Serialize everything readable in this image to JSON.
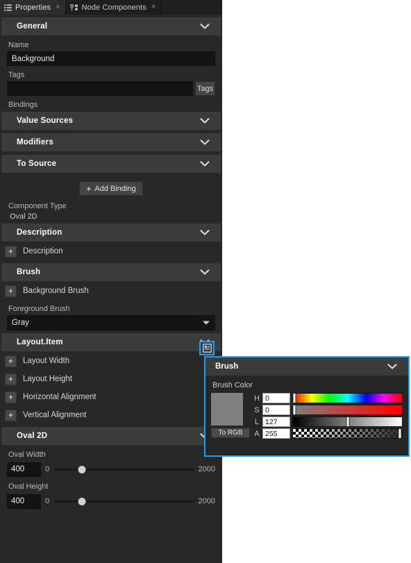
{
  "tabs": [
    {
      "label": "Properties",
      "icon": "list-icon",
      "close": "×",
      "active": true
    },
    {
      "label": "Node Components",
      "icon": "node-graph-icon",
      "close": "×",
      "active": false
    }
  ],
  "sections": {
    "general": {
      "title": "General",
      "chevron": "chevron-down-icon"
    },
    "description": {
      "title": "Description",
      "chevron": "chevron-down-icon"
    },
    "brush": {
      "title": "Brush",
      "chevron": "chevron-down-icon"
    },
    "layout_item": {
      "title": "Layout.Item",
      "chevron": "chevron-down-icon"
    },
    "oval2d": {
      "title": "Oval 2D",
      "chevron": "chevron-down-icon"
    }
  },
  "general": {
    "name_label": "Name",
    "name_value": "Background",
    "tags_label": "Tags",
    "tags_value": "",
    "tags_placeholder": "",
    "tags_button": "Tags",
    "bindings_label": "Bindings",
    "binding_groups": [
      {
        "title": "Value Sources",
        "chevron": "chevron-down-icon"
      },
      {
        "title": "Modifiers",
        "chevron": "chevron-down-icon"
      },
      {
        "title": "To Source",
        "chevron": "chevron-down-icon"
      }
    ],
    "add_binding": "Add Binding",
    "add_binding_plus": "+",
    "component_type_label": "Component Type",
    "component_type_value": "Oval 2D"
  },
  "description_rows": [
    {
      "expander": "+",
      "label": "Description"
    }
  ],
  "brush_section": {
    "rows": [
      {
        "expander": "+",
        "label": "Background Brush"
      }
    ],
    "foreground_label": "Foreground Brush",
    "foreground_value": "Gray",
    "edit_button_icon": "brush-editor-icon"
  },
  "layout_rows": [
    {
      "expander": "+",
      "label": "Layout Width"
    },
    {
      "expander": "+",
      "label": "Layout Height"
    },
    {
      "expander": "+",
      "label": "Horizontal Alignment"
    },
    {
      "expander": "+",
      "label": "Vertical Alignment"
    }
  ],
  "oval2d": {
    "width_label": "Oval Width",
    "width_value": "400",
    "width_min": "0",
    "width_max": "2000",
    "width_percent": 20,
    "height_label": "Oval Height",
    "height_value": "400",
    "height_min": "0",
    "height_max": "2000",
    "height_percent": 20
  },
  "popup": {
    "title": "Brush",
    "chevron": "chevron-down-icon",
    "subtitle": "Brush Color",
    "swatch_color": "#808080",
    "to_rgb_button": "To RGB",
    "channels": [
      {
        "key": "H",
        "label": "H",
        "value": "0",
        "percent": 1
      },
      {
        "key": "S",
        "label": "S",
        "value": "0",
        "percent": 1
      },
      {
        "key": "L",
        "label": "L",
        "value": "127",
        "percent": 50
      },
      {
        "key": "A",
        "label": "A",
        "value": "255",
        "percent": 98
      }
    ]
  },
  "colors": {
    "accent": "#1a9fff",
    "panel_bg": "#282828",
    "section_bg": "#3b3b3b",
    "input_bg": "#141414"
  }
}
